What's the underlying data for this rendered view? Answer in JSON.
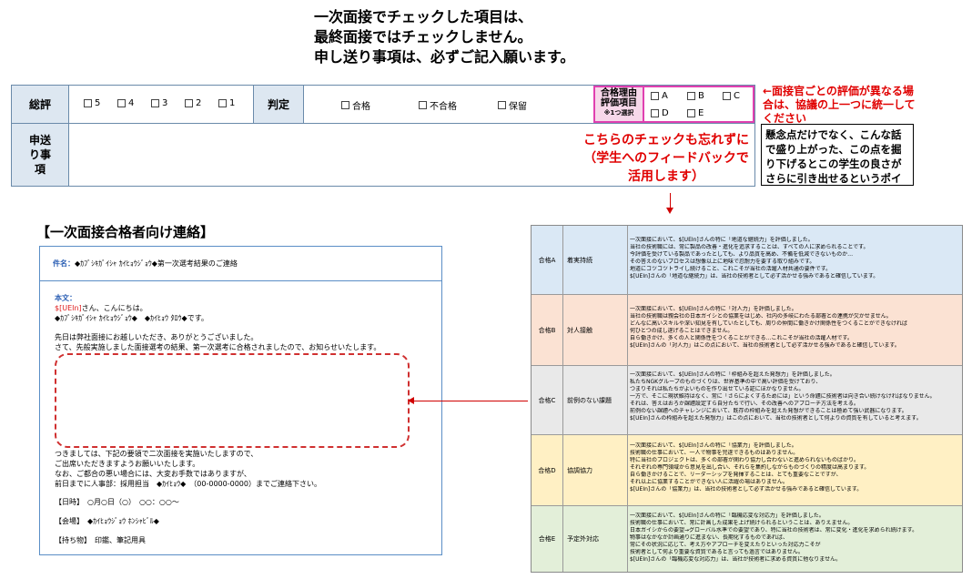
{
  "heading": {
    "line1": "一次面接でチェックした項目は、",
    "line2": "最終面接ではチェックしません。",
    "line3": "申し送り事項は、必ずご記入願います。"
  },
  "evaluation": {
    "overall_label": "総評",
    "scores": [
      "5",
      "4",
      "3",
      "2",
      "1"
    ],
    "judgement_label": "判定",
    "judgements": [
      "合格",
      "不合格",
      "保留"
    ],
    "reason_label_line1": "合格理由",
    "reason_label_line2": "評価項目",
    "reason_label_note": "※1つ選択",
    "reason_options": [
      "A",
      "B",
      "C",
      "D",
      "E"
    ],
    "handover_label": "申送り事項"
  },
  "notes": {
    "interviewer_note": "←面接官ごとの評価が異なる場合は、協議の上一つに統一してください",
    "handover_note": "懸念点だけでなく、こんな話で盛り上がった、この点を掘り下げるとこの学生の良さがさらに引き出せるというポイントも",
    "check_reminder_line1": "こちらのチェックも忘れずに",
    "check_reminder_line2": "（学生へのフィードバックで",
    "check_reminder_line3": "活用します）"
  },
  "section_title": "【一次面接合格者向け連絡】",
  "email": {
    "subject_label": "件名：",
    "subject_text": "◆ｶﾌﾞｼｷｶﾞｲｼｬ ｶｲﾋｮｳｼﾞｮｳ◆第一次選考結果のご連絡",
    "body_label": "本文：",
    "greeting_var": "$[UEIn]",
    "greeting_text": "さん、こんにちは。",
    "company_line": "◆ｶﾌﾞｼｷｶﾞｲｼｬ ｶｲﾋｮｳｼﾞｮｳ◆　◆ｶｲﾋｮｳ ﾀﾛｳ◆です。",
    "thanks_line": "先日は弊社面接にお越しいただき、ありがとうございました。",
    "result_line": "さて、先般実施しました面接選考の結果、第一次選考に合格されましたので、お知らせいたします。",
    "next_line": "つきましては、下記の要領で二次面接を実施いたしますので、",
    "attend_line": "ご出席いただきますようお願いいたします。",
    "contact_line1": "なお、ご都合の悪い場合には、大変お手数ではありますが、",
    "contact_line2": "前日までに人事部：採用担当　◆ｶｲﾋｮｳ◆　（00-0000-0000）までご連絡下さい。",
    "date_label": "【日時】",
    "date_value": "○月○日（○）　○○：○○～",
    "venue_label": "【会場】",
    "venue_value": "◆ｶｲﾋｮｳｼﾞｮｳ ﾎﾝｼｬﾋﾞﾙ◆",
    "items_label": "【持ち物】",
    "items_value": "印鑑、筆記用具"
  },
  "criteria": [
    {
      "code": "合格A",
      "name": "着実持続",
      "lines": [
        "一次面接において、$[UEIn]さんの特に「地道な継続力」を評価しました。",
        "当社の技術職には、常に製品の改善・進化を追求することは、すべての人に求められることです。",
        "今評価を受けている製品であったとしても、より品質を高め、不備を低減できないものか…",
        "その答えのないプロセスは想像以上に地味で忍耐力を要する取り組みです。",
        "地道にコツコツトライし続けること、これこそが当社の活躍人材共通の要件です。",
        "$[UEIn]さんの「地道な継続力」は、当社の技術者として必ず活かせる強みであると確信しています。"
      ]
    },
    {
      "code": "合格B",
      "name": "対人接触",
      "lines": [
        "一次面接において、$[UEIn]さんの特に「対人力」を評価しました。",
        "当社の技術職は親会社の日本ガイシとの協業をはじめ、社内の多岐にわたる部署との連携が欠かせません。",
        "どんなに高いスキルや深い知見を有していたとしても、周りの仲間に働きかけ関係性をつくることができなければ",
        "何ひとつの成し遂げることはできません。",
        "自ら働きかけ、多くの人と関係性をつくることができる…これこそが当社の活躍人材です。",
        "$[UEIn]さんの「対人力」はこの点において、当社の技術者として必ず活かせる強みであると確信しています。"
      ]
    },
    {
      "code": "合格C",
      "name": "前例のない課題",
      "lines": [
        "一次面接において、$[UEIn]さんの特に「枠組みを超えた発想力」を評価しました。",
        "私たちNGKグループのものづくりは、世界基準の中で高い評価を受けており、",
        "つまりそれは私たちがよいものを作り出せている証にほかなりません。",
        "一方で、そこに現状維持はなく、常に「さらによくするためには」という命題に技術者は向き合い続けなければなりません。",
        "それは、答えはおろか課題設定すら自分たちで行い、その改善へのアプローチ方法を考える。",
        "前例のない課題へのチャレンジにおいて、既存の枠組みを超えた発想ができることは極めて強い武器になります。",
        "$[UEIn]さんの枠組みを超えた発想力」はこの点において、当社の技術者として何よりの資質を有していると考えます。"
      ]
    },
    {
      "code": "合格D",
      "name": "協調協力",
      "lines": [
        "一次面接において、$[UEIn]さんの特に「協業力」を評価しました。",
        "技術職の仕事において、一人で物事を完遂できるものはありません。",
        "特に当社のプロジェクトは、多くの部署が関わり協力し合わないと進められないものばかり。",
        "それぞれの専門領域から意見を出し合い、それらを集約しながらものづくりの精度は高まります。",
        "自ら働きかけることで、リーダーシップを発揮することは、とても重要なことですが、",
        "それ以上に協業することができない人に活躍の場はありません。",
        "$[UEIn]さんの「協業力」は、当社の技術者として必ず活かせる強みであると確信しています。"
      ]
    },
    {
      "code": "合格E",
      "name": "予定外対応",
      "lines": [
        "一次面接において、$[UEIn]さんの特に「臨機応変な対応力」を評価しました。",
        "技術職の仕事において、常に計画した成果を上げ続けられるということは、ありえません。",
        "日本ガイシからの要望→グローバル水準での要望であり、特に当社の技術者は、常に変化・進化を求められ続けます。",
        "物事はなかなか計画通りに進まない、長期化するものであれば、",
        "常にその状況に応じて、考え方やアプローチを変えたりといった対応力こそが",
        "技術者として何より重要な資質であると言っても過言ではありません。",
        "$[UEIn]さんの「臨機応変な対応力」は、当社が技術者に求める資質に他なりません。"
      ]
    }
  ],
  "colors": {
    "header_bg": "#dde7f1",
    "accent_red": "#e00000",
    "pink_border": "#e040b0",
    "mail_border": "#5a8ec6",
    "row_a": "#dae8f5",
    "row_b": "#fbe2d3",
    "row_c": "#e9e9e9",
    "row_d": "#fff0c4",
    "row_e": "#e3efd9"
  }
}
